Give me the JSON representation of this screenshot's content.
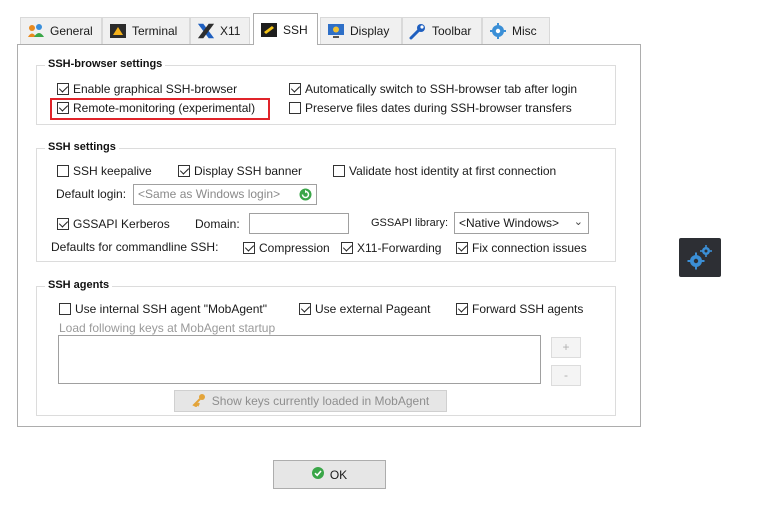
{
  "tabs": [
    {
      "label": "General",
      "icon": "people-icon",
      "active": false
    },
    {
      "label": "Terminal",
      "icon": "terminal-icon",
      "active": false
    },
    {
      "label": "X11",
      "icon": "x11-icon",
      "active": false
    },
    {
      "label": "SSH",
      "icon": "ssh-icon",
      "active": true
    },
    {
      "label": "Display",
      "icon": "monitor-icon",
      "active": false
    },
    {
      "label": "Toolbar",
      "icon": "wrench-icon",
      "active": false
    },
    {
      "label": "Misc",
      "icon": "gear-icon",
      "active": false
    }
  ],
  "ssh_browser": {
    "title": "SSH-browser settings",
    "enable_graphical": {
      "label": "Enable graphical SSH-browser",
      "checked": true
    },
    "auto_switch": {
      "label": "Automatically switch to SSH-browser tab after login",
      "checked": true
    },
    "remote_monitoring": {
      "label": "Remote-monitoring (experimental)",
      "checked": true
    },
    "preserve_dates": {
      "label": "Preserve files dates during SSH-browser transfers",
      "checked": false
    }
  },
  "ssh_settings": {
    "title": "SSH settings",
    "keepalive": {
      "label": "SSH keepalive",
      "checked": false
    },
    "display_banner": {
      "label": "Display SSH banner",
      "checked": true
    },
    "validate_host": {
      "label": "Validate host identity at first connection",
      "checked": false
    },
    "default_login_label": "Default login:",
    "default_login_placeholder": "<Same as Windows login>",
    "gssapi": {
      "label": "GSSAPI Kerberos",
      "checked": true
    },
    "domain_label": "Domain:",
    "domain_value": "",
    "gssapi_library_label": "GSSAPI library:",
    "gssapi_library_value": "<Native Windows>",
    "defaults_label": "Defaults for commandline SSH:",
    "compression": {
      "label": "Compression",
      "checked": true
    },
    "x11_forwarding": {
      "label": "X11-Forwarding",
      "checked": true
    },
    "fix_connection": {
      "label": "Fix connection issues",
      "checked": true
    }
  },
  "ssh_agents": {
    "title": "SSH agents",
    "internal_agent": {
      "label": "Use internal SSH agent \"MobAgent\"",
      "checked": false
    },
    "external_pageant": {
      "label": "Use external Pageant",
      "checked": true
    },
    "forward_agents": {
      "label": "Forward SSH agents",
      "checked": true
    },
    "load_keys_label": "Load following keys at MobAgent startup",
    "add_label": "+",
    "remove_label": "-",
    "show_keys_label": "Show keys currently loaded in MobAgent"
  },
  "ok_label": "OK",
  "colors": {
    "highlight": "#e0242a",
    "ok_green": "#3aa648",
    "gear_blue": "#3b8fd6",
    "badge_bg": "#2d2f34"
  }
}
